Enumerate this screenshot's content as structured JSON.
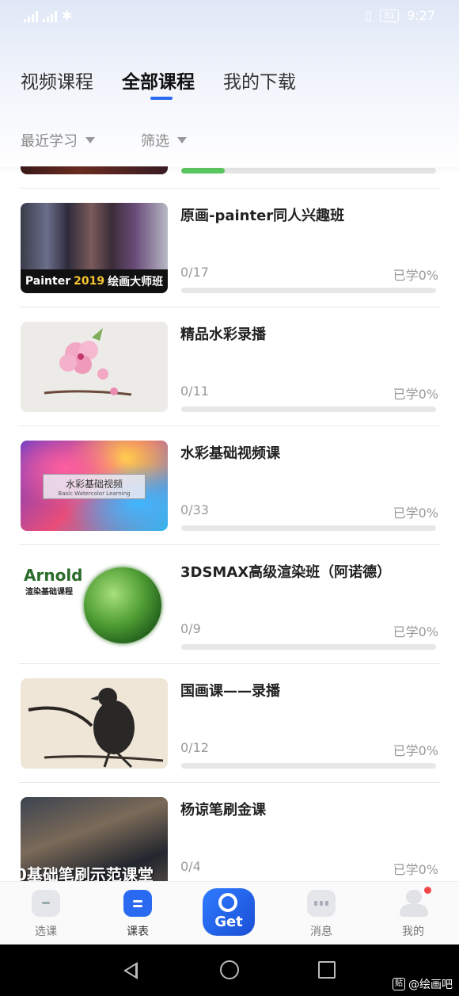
{
  "status_bar": {
    "battery": "81",
    "time": "9:27"
  },
  "tabs": [
    {
      "label": "视频课程",
      "active": false
    },
    {
      "label": "全部课程",
      "active": true
    },
    {
      "label": "我的下载",
      "active": false
    }
  ],
  "filters": {
    "sort_label": "最近学习",
    "filter_label": "筛选"
  },
  "partial_course": {
    "progress": 0.17
  },
  "courses": [
    {
      "title": "原画-painter同人兴趣班",
      "count": "0/17",
      "percent": "已学0%",
      "thumb_text": "Painter",
      "thumb_year": "2019",
      "thumb_text2": "绘画大师班"
    },
    {
      "title": "精品水彩录播",
      "count": "0/11",
      "percent": "已学0%"
    },
    {
      "title": "水彩基础视频课",
      "count": "0/33",
      "percent": "已学0%",
      "thumb_text": "水彩基础视频",
      "thumb_sub": "Basic Watercolor Learning"
    },
    {
      "title": "3DSMAX高级渲染班（阿诺德）",
      "count": "0/9",
      "percent": "已学0%",
      "thumb_text": "Arnold",
      "thumb_text2": "渲染基础课程"
    },
    {
      "title": "国画课——录播",
      "count": "0/12",
      "percent": "已学0%"
    },
    {
      "title": "杨谅笔刷金课",
      "count": "0/4",
      "percent": "已学0%",
      "thumb_text": "0基础笔刷示范课堂"
    }
  ],
  "bottom_nav": [
    {
      "label": "选课",
      "icon": "course-select-icon"
    },
    {
      "label": "课表",
      "icon": "schedule-icon"
    },
    {
      "label": "Get",
      "icon": "get-logo-icon"
    },
    {
      "label": "消息",
      "icon": "message-icon"
    },
    {
      "label": "我的",
      "icon": "profile-icon"
    }
  ],
  "watermark": "@绘画吧",
  "colors": {
    "accent": "#2a6af0",
    "progress": "#5cc760",
    "badge": "#f04848"
  }
}
